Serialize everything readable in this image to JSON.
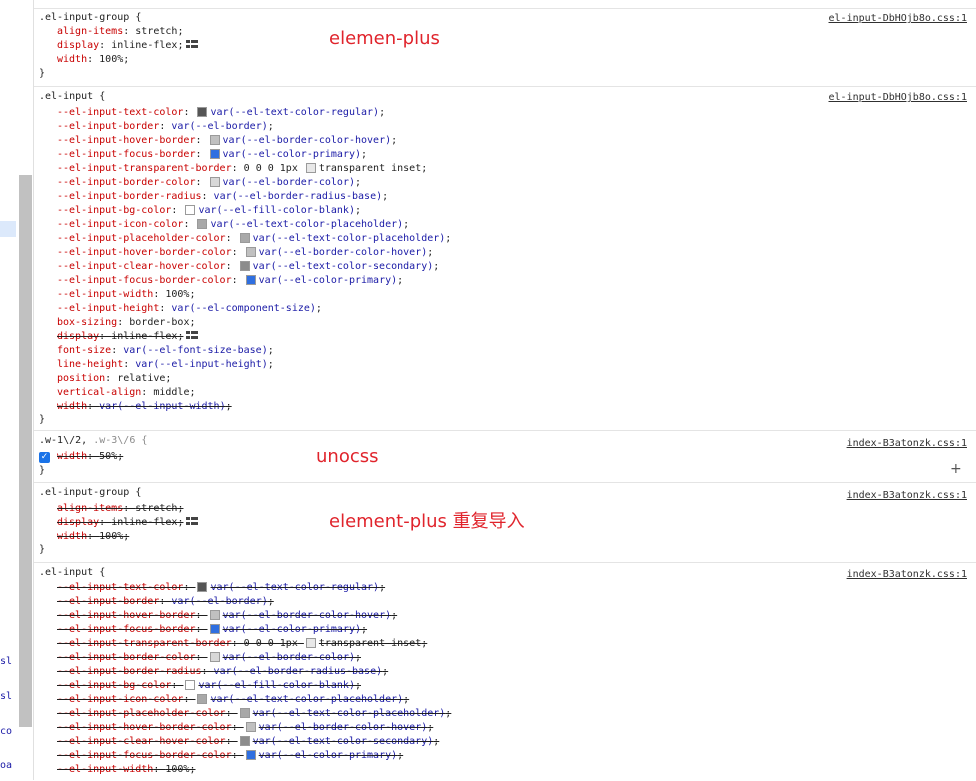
{
  "gutter": {
    "labels": [
      "sl",
      "sl",
      "co",
      "oa"
    ]
  },
  "annotations": {
    "first": "elemen-plus",
    "second": "unocss",
    "third": "element-plus 重复导入"
  },
  "rules": [
    {
      "selector": ".el-input-group {",
      "source": "el-input-DbHOjb8o.css:1",
      "decls": [
        {
          "prop": "align-items",
          "val": "stretch"
        },
        {
          "prop": "display",
          "val": "inline-flex"
        },
        {
          "prop": "width",
          "val": "100%"
        }
      ]
    },
    {
      "selector": ".el-input {",
      "source": "el-input-DbHOjb8o.css:1",
      "decls": [
        {
          "prop": "--el-input-text-color",
          "val": "var(--el-text-color-regular)"
        },
        {
          "prop": "--el-input-border",
          "val": "var(--el-border)"
        },
        {
          "prop": "--el-input-hover-border",
          "val": "var(--el-border-color-hover)"
        },
        {
          "prop": "--el-input-focus-border",
          "val": "var(--el-color-primary)"
        },
        {
          "prop": "--el-input-transparent-border",
          "val": "0 0 0 1px",
          "val2": "transparent inset"
        },
        {
          "prop": "--el-input-border-color",
          "val": "var(--el-border-color)"
        },
        {
          "prop": "--el-input-border-radius",
          "val": "var(--el-border-radius-base)"
        },
        {
          "prop": "--el-input-bg-color",
          "val": "var(--el-fill-color-blank)"
        },
        {
          "prop": "--el-input-icon-color",
          "val": "var(--el-text-color-placeholder)"
        },
        {
          "prop": "--el-input-placeholder-color",
          "val": "var(--el-text-color-placeholder)"
        },
        {
          "prop": "--el-input-hover-border-color",
          "val": "var(--el-border-color-hover)"
        },
        {
          "prop": "--el-input-clear-hover-color",
          "val": "var(--el-text-color-secondary)"
        },
        {
          "prop": "--el-input-focus-border-color",
          "val": "var(--el-color-primary)"
        },
        {
          "prop": "--el-input-width",
          "val": "100%"
        },
        {
          "prop": "--el-input-height",
          "val": "var(--el-component-size)"
        },
        {
          "prop": "box-sizing",
          "val": "border-box"
        },
        {
          "prop": "display",
          "val": "inline-flex"
        },
        {
          "prop": "font-size",
          "val": "var(--el-font-size-base)"
        },
        {
          "prop": "line-height",
          "val": "var(--el-input-height)"
        },
        {
          "prop": "position",
          "val": "relative"
        },
        {
          "prop": "vertical-align",
          "val": "middle"
        },
        {
          "prop": "width",
          "val": "var(--el-input-width)"
        }
      ]
    },
    {
      "selector_main": ".w-1\\/2,",
      "selector_dim": " .w-3\\/6 {",
      "source": "index-B3atonzk.css:1",
      "decls": [
        {
          "prop": "width",
          "val": "50%"
        }
      ]
    },
    {
      "selector": ".el-input-group {",
      "source": "index-B3atonzk.css:1",
      "decls": [
        {
          "prop": "align-items",
          "val": "stretch"
        },
        {
          "prop": "display",
          "val": "inline-flex"
        },
        {
          "prop": "width",
          "val": "100%"
        }
      ]
    },
    {
      "selector": ".el-input {",
      "source": "index-B3atonzk.css:1",
      "decls": [
        {
          "prop": "--el-input-text-color",
          "val": "var(--el-text-color-regular)"
        },
        {
          "prop": "--el-input-border",
          "val": "var(--el-border)"
        },
        {
          "prop": "--el-input-hover-border",
          "val": "var(--el-border-color-hover)"
        },
        {
          "prop": "--el-input-focus-border",
          "val": "var(--el-color-primary)"
        },
        {
          "prop": "--el-input-transparent-border",
          "val": "0 0 0 1px",
          "val2": "transparent inset"
        },
        {
          "prop": "--el-input-border-color",
          "val": "var(--el-border-color)"
        },
        {
          "prop": "--el-input-border-radius",
          "val": "var(--el-border-radius-base)"
        },
        {
          "prop": "--el-input-bg-color",
          "val": "var(--el-fill-color-blank)"
        },
        {
          "prop": "--el-input-icon-color",
          "val": "var(--el-text-color-placeholder)"
        },
        {
          "prop": "--el-input-placeholder-color",
          "val": "var(--el-text-color-placeholder)"
        },
        {
          "prop": "--el-input-hover-border-color",
          "val": "var(--el-border-color-hover)"
        },
        {
          "prop": "--el-input-clear-hover-color",
          "val": "var(--el-text-color-secondary)"
        },
        {
          "prop": "--el-input-focus-border-color",
          "val": "var(--el-color-primary)"
        },
        {
          "prop": "--el-input-width",
          "val": "100%"
        }
      ]
    }
  ],
  "closing_brace": "}",
  "colors": {
    "text_regular": "#555555",
    "border": "#d8d8d8",
    "primary": "#2f6fe0",
    "placeholder": "#a8a8a8",
    "secondary": "#8c8c8c",
    "blank": "#ffffff"
  }
}
